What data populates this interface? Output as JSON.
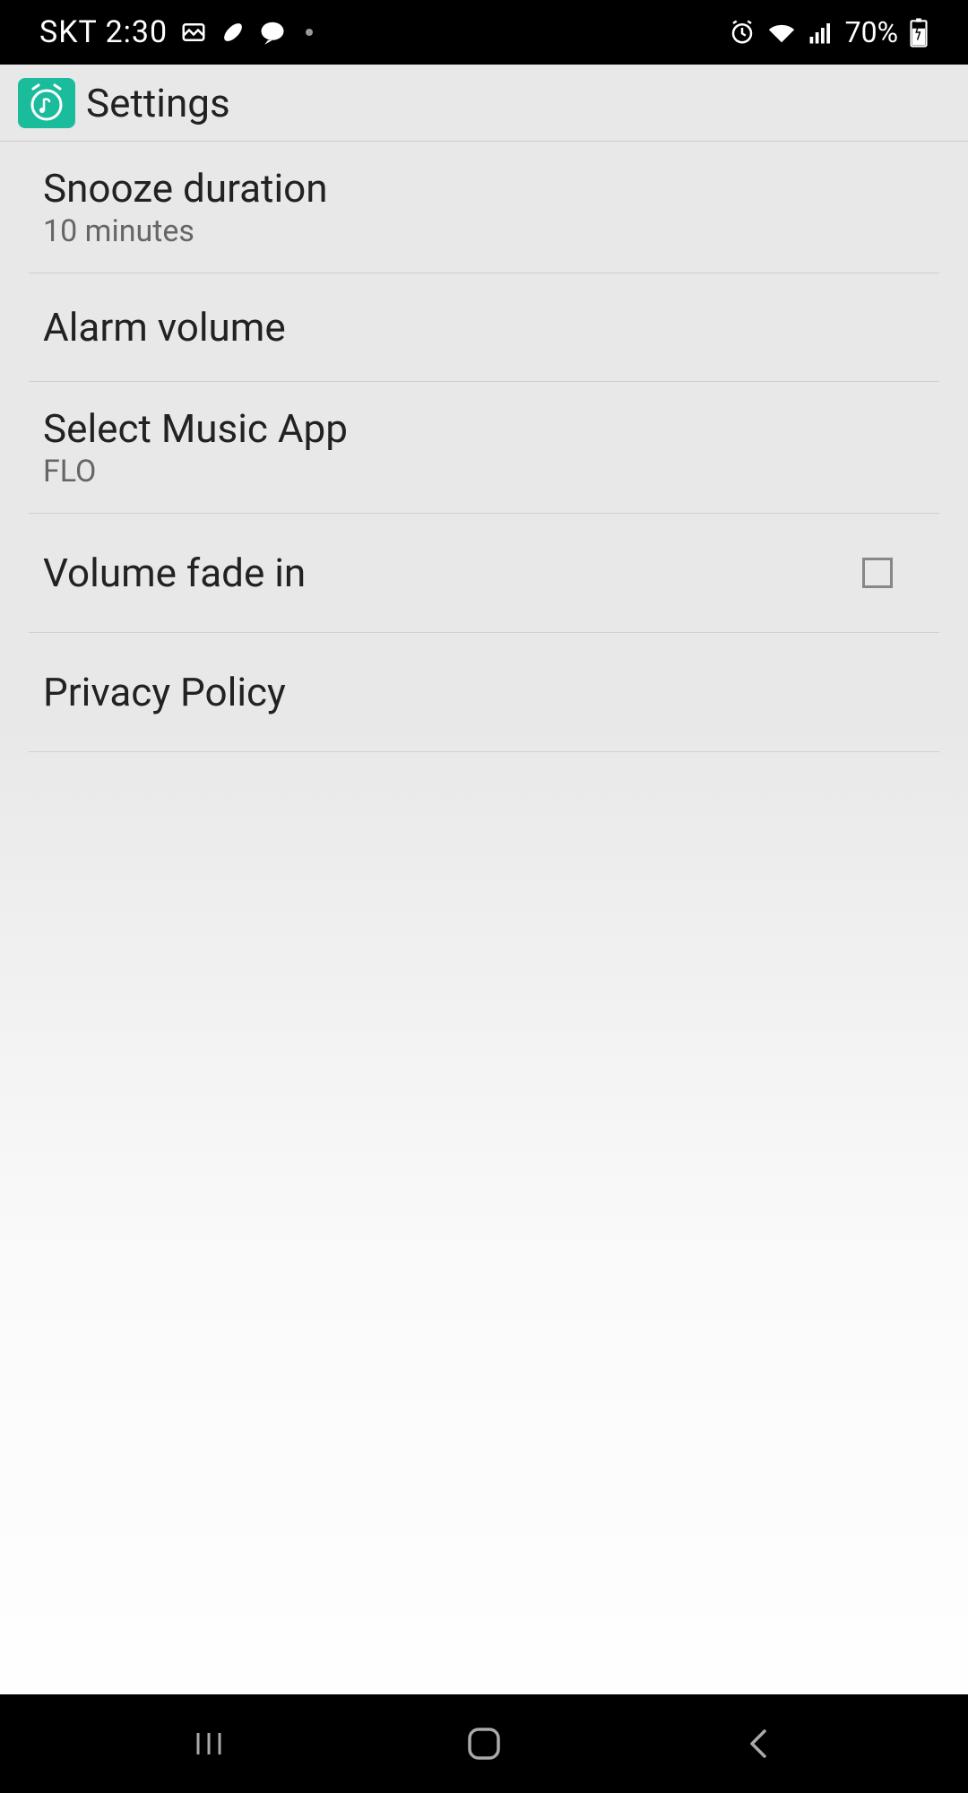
{
  "status_bar": {
    "carrier_time": "SKT 2:30",
    "battery": "70%"
  },
  "app_bar": {
    "title": "Settings"
  },
  "settings": {
    "snooze": {
      "title": "Snooze duration",
      "value": "10 minutes"
    },
    "alarm_volume": {
      "title": "Alarm volume"
    },
    "music_app": {
      "title": "Select Music App",
      "value": "FLO"
    },
    "volume_fade": {
      "title": "Volume fade in",
      "checked": false
    },
    "privacy": {
      "title": "Privacy Policy"
    }
  }
}
